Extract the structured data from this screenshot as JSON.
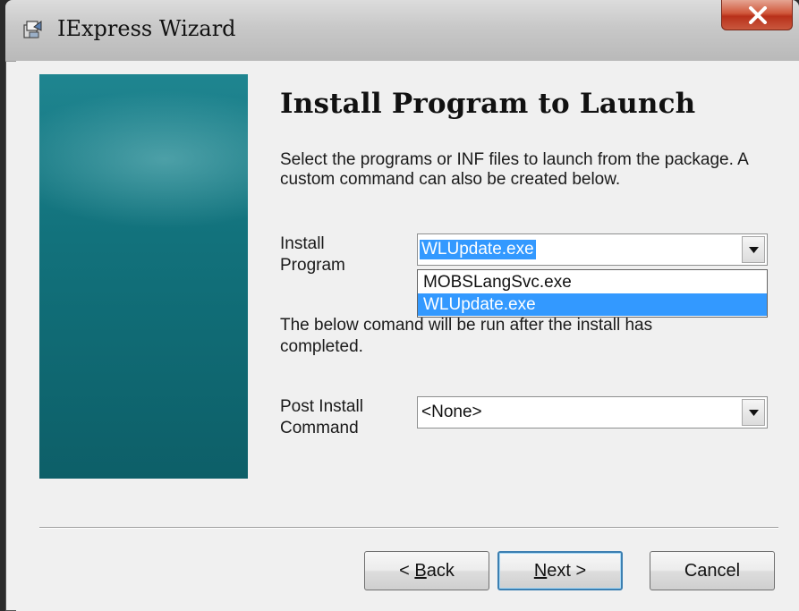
{
  "window": {
    "title": "IExpress Wizard"
  },
  "page": {
    "heading": "Install Program to Launch",
    "description": "Select the programs or INF files to launch from the package.  A custom command can also be created below."
  },
  "install_program": {
    "label_line1": "Install",
    "label_line2": "Program",
    "selected_value": "WLUpdate.exe",
    "options": [
      "MOBSLangSvc.exe",
      "WLUpdate.exe"
    ],
    "highlighted_option": "WLUpdate.exe"
  },
  "post_install": {
    "note": "The below comand will be run after the install has completed.",
    "label_line1": "Post Install",
    "label_line2": "Command",
    "selected_value": "<None>"
  },
  "buttons": {
    "back_prefix": "< ",
    "back_mnemonic": "B",
    "back_rest": "ack",
    "next_mnemonic": "N",
    "next_rest": "ext >",
    "cancel": "Cancel"
  },
  "colors": {
    "selection": "#3399ff",
    "side_panel": "#12727c",
    "close_button": "#c9402a"
  }
}
